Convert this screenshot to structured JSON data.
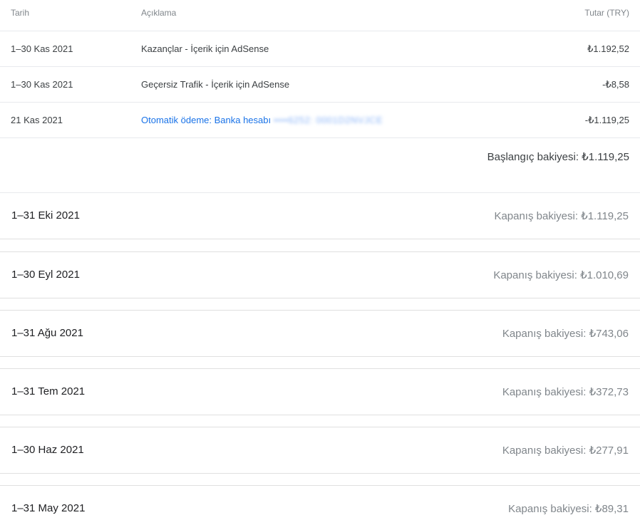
{
  "table": {
    "headers": {
      "date": "Tarih",
      "description": "Açıklama",
      "amount": "Tutar (TRY)"
    },
    "rows": [
      {
        "date": "1–30 Kas 2021",
        "description": "Kazançlar - İçerik için AdSense",
        "amount": "₺1.192,52"
      },
      {
        "date": "1–30 Kas 2021",
        "description": "Geçersiz Trafik - İçerik için AdSense",
        "amount": "-₺8,58"
      },
      {
        "date": "21 Kas 2021",
        "description": "Otomatik ödeme: Banka hesabı",
        "masked": "••••6252: 0001D2NVJCE",
        "amount": "-₺1.119,25"
      }
    ],
    "opening_balance": "Başlangıç bakiyesi: ₺1.119,25"
  },
  "months": [
    {
      "date": "1–31 Eki 2021",
      "balance": "Kapanış bakiyesi: ₺1.119,25"
    },
    {
      "date": "1–30 Eyl 2021",
      "balance": "Kapanış bakiyesi: ₺1.010,69"
    },
    {
      "date": "1–31 Ağu 2021",
      "balance": "Kapanış bakiyesi: ₺743,06"
    },
    {
      "date": "1–31 Tem 2021",
      "balance": "Kapanış bakiyesi: ₺372,73"
    },
    {
      "date": "1–30 Haz 2021",
      "balance": "Kapanış bakiyesi: ₺277,91"
    },
    {
      "date": "1–31 May 2021",
      "balance": "Kapanış bakiyesi: ₺89,31"
    }
  ]
}
